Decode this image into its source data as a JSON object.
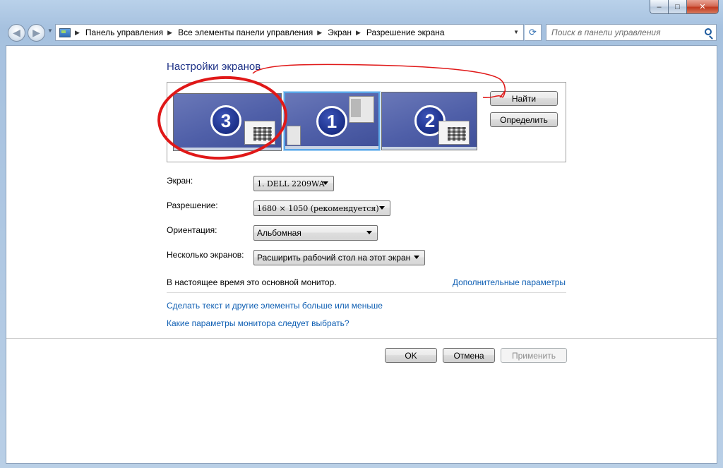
{
  "window": {
    "caption_buttons": {
      "minimize": "–",
      "maximize": "□",
      "close": "✕"
    }
  },
  "nav": {
    "back_glyph": "◀",
    "forward_glyph": "▶",
    "breadcrumbs": [
      "Панель управления",
      "Все элементы панели управления",
      "Экран",
      "Разрешение экрана"
    ],
    "search_placeholder": "Поиск в панели управления"
  },
  "display_settings": {
    "title": "Настройки экранов",
    "monitors": [
      {
        "number": "3"
      },
      {
        "number": "1"
      },
      {
        "number": "2"
      }
    ],
    "find_button": "Найти",
    "identify_button": "Определить"
  },
  "form": {
    "screen_label": "Экран:",
    "screen_value": "1. DELL 2209WA",
    "resolution_label": "Разрешение:",
    "resolution_value": "1680 × 1050 (рекомендуется)",
    "orientation_label": "Ориентация:",
    "orientation_value": "Альбомная",
    "multi_label": "Несколько экранов:",
    "multi_value": "Расширить рабочий стол на этот экран"
  },
  "info": {
    "status": "В настоящее время это основной монитор.",
    "advanced_link": "Дополнительные параметры",
    "text_size_link": "Сделать текст и другие элементы больше или меньше",
    "monitor_help_link": "Какие параметры монитора следует выбрать?"
  },
  "dialog_buttons": {
    "ok": "OK",
    "cancel": "Отмена",
    "apply": "Применить"
  },
  "annotation_color": "#e01818"
}
